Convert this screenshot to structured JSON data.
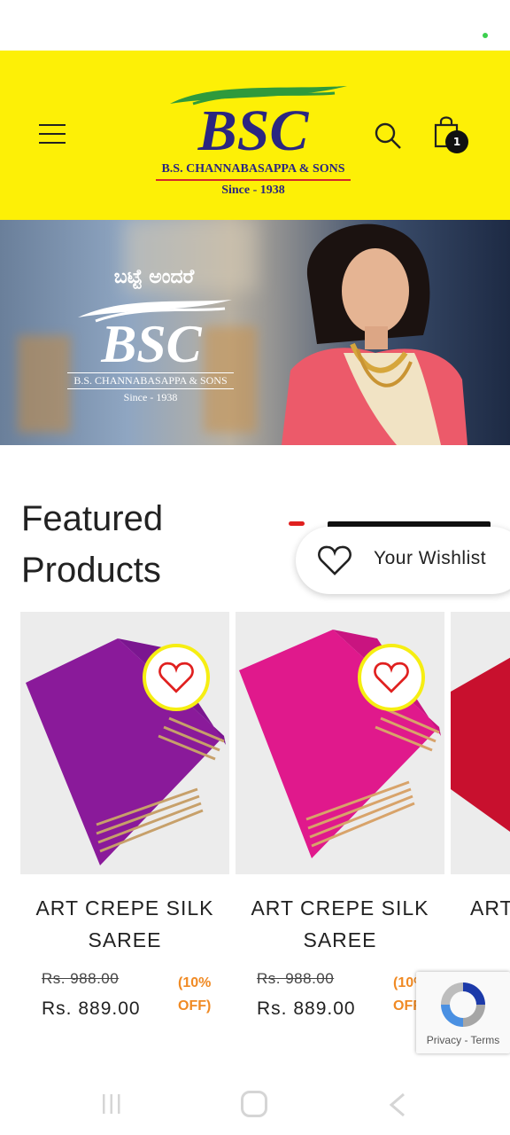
{
  "header": {
    "brand_letters": "BSC",
    "brand_name": "B.S. CHANNABASAPPA & SONS",
    "since": "Since - 1938",
    "cart_count": "1"
  },
  "banner": {
    "kannada_text": "ಬಟ್ಟೆ ಅಂದರೆ",
    "brand_letters": "BSC",
    "brand_name": "B.S. CHANNABASAPPA & SONS",
    "since": "Since - 1938"
  },
  "featured": {
    "title_line1": "Featured",
    "title_line2": "Products"
  },
  "wishlist": {
    "label": "Your Wishlist"
  },
  "products": [
    {
      "title_line1": "ART CREPE SILK",
      "title_line2": "SAREE",
      "old_price": "Rs. 988.00",
      "new_price": "Rs. 889.00",
      "discount_line1": "(10%",
      "discount_line2": "OFF)",
      "color": "#8a1a9a"
    },
    {
      "title_line1": "ART CREPE SILK",
      "title_line2": "SAREE",
      "old_price": "Rs. 988.00",
      "new_price": "Rs. 889.00",
      "discount_line1": "(10%",
      "discount_line2": "OFF)",
      "color": "#e0198c"
    },
    {
      "title_line1": "ART",
      "color": "#c8102e"
    }
  ],
  "recaptcha": {
    "links": "Privacy - Terms"
  },
  "colors": {
    "header_bg": "#fdf006",
    "accent_red": "#e0201f",
    "discount": "#f08a24"
  }
}
